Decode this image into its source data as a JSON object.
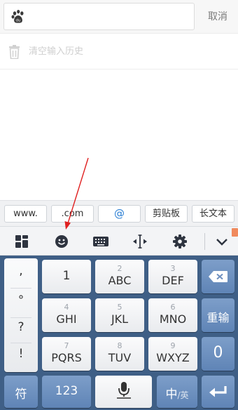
{
  "search": {
    "value": "",
    "cancel_label": "取消"
  },
  "history": {
    "clear_label": "清空输入历史"
  },
  "shortcuts": {
    "www": "www.",
    "com": ".com",
    "at": "@",
    "clipboard": "剪贴板",
    "longtext": "长文本"
  },
  "toolbar": {
    "icons": [
      "apps-grid-icon",
      "emoji-icon",
      "keyboard-icon",
      "cursor-move-icon",
      "gear-icon",
      "collapse-chevron-icon"
    ]
  },
  "keyboard": {
    "punct": [
      ",",
      "°",
      "?",
      "!"
    ],
    "keys": [
      {
        "digit": "",
        "letters": "1"
      },
      {
        "digit": "2",
        "letters": "ABC"
      },
      {
        "digit": "3",
        "letters": "DEF"
      },
      {
        "digit": "4",
        "letters": "GHI"
      },
      {
        "digit": "5",
        "letters": "JKL"
      },
      {
        "digit": "6",
        "letters": "MNO"
      },
      {
        "digit": "7",
        "letters": "PQRS"
      },
      {
        "digit": "8",
        "letters": "TUV"
      },
      {
        "digit": "9",
        "letters": "WXYZ"
      }
    ],
    "reinput": "重输",
    "zero": "0",
    "symbol": "符",
    "num_mode": "123",
    "lang_main": "中",
    "lang_alt": "/英"
  },
  "colors": {
    "keyboard_bg": "#3f5f86",
    "blue_key": "#6d8fbf",
    "annotation_arrow": "#e02020",
    "link_blue": "#2a7ed3"
  }
}
